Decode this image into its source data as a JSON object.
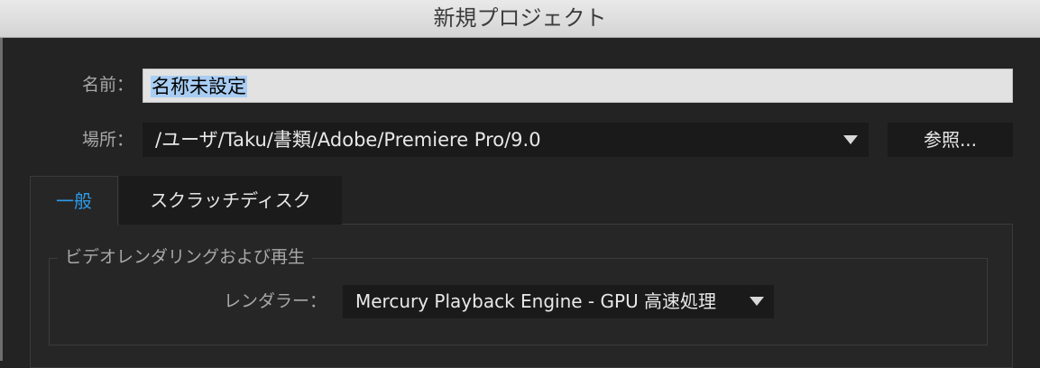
{
  "window": {
    "title": "新規プロジェクト"
  },
  "name_row": {
    "label": "名前：",
    "value": "名称未設定"
  },
  "location_row": {
    "label": "場所：",
    "value": "/ユーザ/Taku/書類/Adobe/Premiere Pro/9.0",
    "dropdown_icon": "triangle-down",
    "browse_label": "参照..."
  },
  "tabs": [
    {
      "label": "一般",
      "active": true
    },
    {
      "label": "スクラッチディスク",
      "active": false
    }
  ],
  "video_group": {
    "title": "ビデオレンダリングおよび再生",
    "renderer_label": "レンダラー：",
    "renderer_value": "Mercury Playback Engine - GPU 高速処理",
    "dropdown_icon": "triangle-down"
  },
  "colors": {
    "accent": "#2d9ae8",
    "selection": "#a9cdf3",
    "background": "#232323"
  }
}
